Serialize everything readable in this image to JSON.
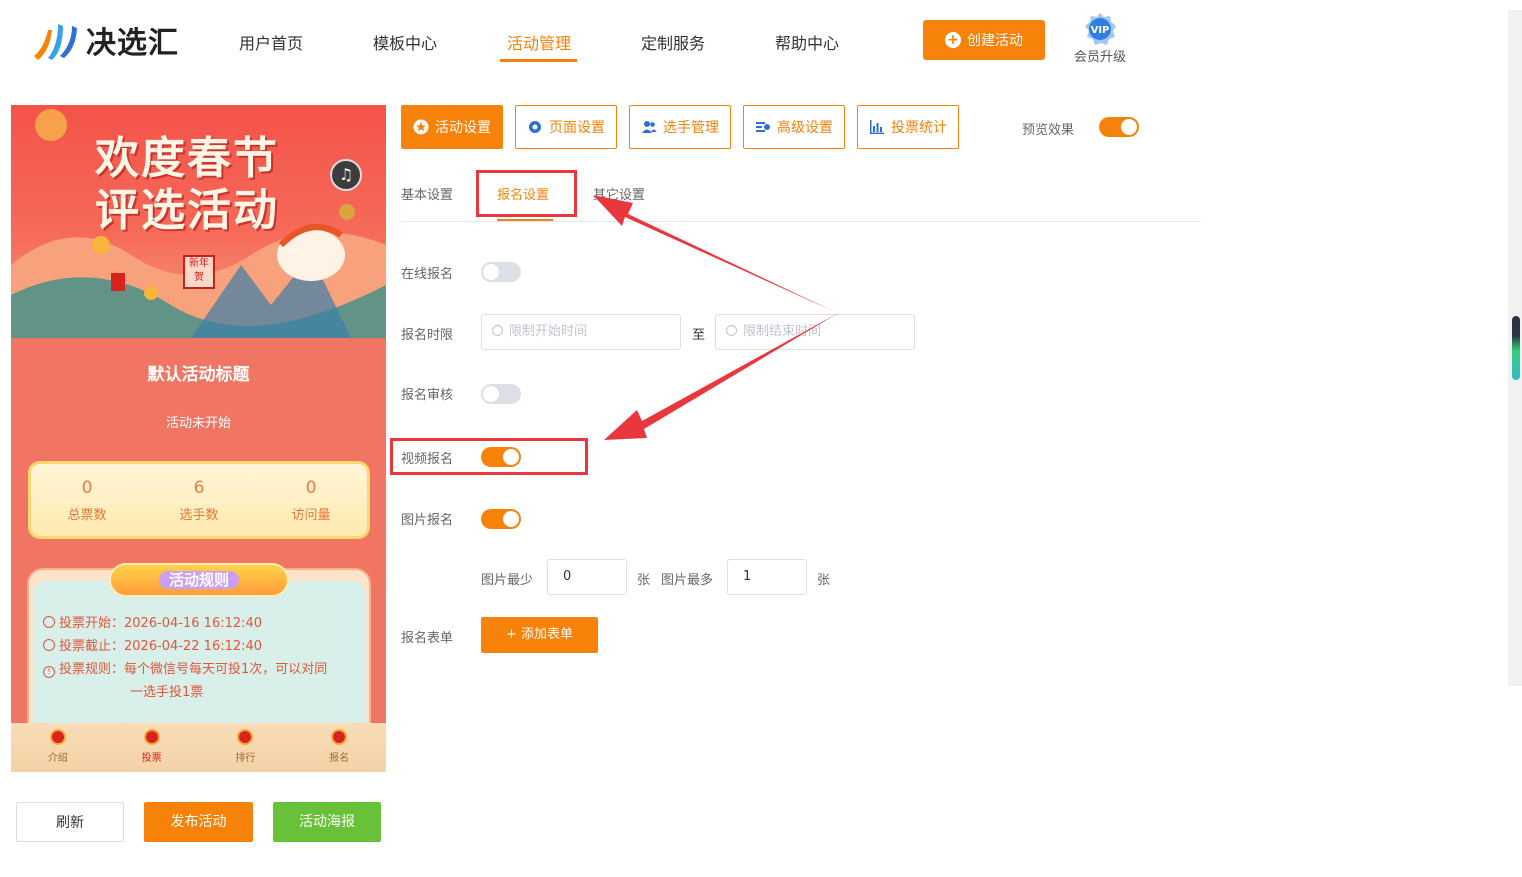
{
  "header": {
    "logo_text": "决选汇",
    "nav": [
      "用户首页",
      "模板中心",
      "活动管理",
      "定制服务",
      "帮助中心"
    ],
    "active_nav": "活动管理",
    "create_button": "创建活动",
    "vip_badge": "VIP",
    "vip_label": "会员升级"
  },
  "preview": {
    "banner_title_line1": "欢度春节",
    "banner_title_line2": "评选活动",
    "banner_stamp": "新年贺",
    "activity_title": "默认活动标题",
    "activity_status": "活动未开始",
    "stats": [
      {
        "value": "0",
        "label": "总票数"
      },
      {
        "value": "6",
        "label": "选手数"
      },
      {
        "value": "0",
        "label": "访问量"
      }
    ],
    "rules_header": "活动规则",
    "rules": {
      "start": "投票开始：2026-04-16 16:12:40",
      "end": "投票截止：2026-04-22 16:12:40",
      "rule_line1": "投票规则：每个微信号每天可投1次，可以对同",
      "rule_line2": "一选手投1票"
    },
    "tabbar": [
      "介绍",
      "投票",
      "排行",
      "报名"
    ]
  },
  "bottom_buttons": {
    "refresh": "刷新",
    "publish": "发布活动",
    "poster": "活动海报"
  },
  "toolbar": {
    "items": [
      "活动设置",
      "页面设置",
      "选手管理",
      "高级设置",
      "投票统计"
    ],
    "preview_label": "预览效果",
    "preview_on": true
  },
  "subtabs": {
    "items": [
      "基本设置",
      "报名设置",
      "其它设置"
    ],
    "active": "报名设置"
  },
  "form": {
    "online_signup": {
      "label": "在线报名",
      "on": false
    },
    "time_limit": {
      "label": "报名时限",
      "start_placeholder": "限制开始时间",
      "separator": "至",
      "end_placeholder": "限制结束时间"
    },
    "review": {
      "label": "报名审核",
      "on": false
    },
    "video_signup": {
      "label": "视频报名",
      "on": true
    },
    "image_signup": {
      "label": "图片报名",
      "on": true
    },
    "image_limits": {
      "min_label": "图片最少",
      "min_value": "0",
      "unit1": "张",
      "max_label": "图片最多",
      "max_value": "1",
      "unit2": "张"
    },
    "signup_form": {
      "label": "报名表单",
      "button": "+ 添加表单"
    }
  },
  "colors": {
    "accent": "#f7820a",
    "green": "#67c23a",
    "annotation_red": "#e8383d"
  }
}
